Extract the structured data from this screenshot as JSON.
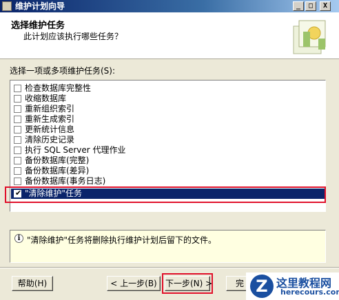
{
  "window": {
    "title": "维护计划向导",
    "minimize": "_",
    "maximize": "□",
    "close": "X"
  },
  "header": {
    "title": "选择维护任务",
    "subtitle": "此计划应该执行哪些任务？"
  },
  "task_list": {
    "label": "选择一项或多项维护任务(S):",
    "items": [
      {
        "label": "检查数据库完整性",
        "checked": false
      },
      {
        "label": "收缩数据库",
        "checked": false
      },
      {
        "label": "重新组织索引",
        "checked": false
      },
      {
        "label": "重新生成索引",
        "checked": false
      },
      {
        "label": "更新统计信息",
        "checked": false
      },
      {
        "label": "清除历史记录",
        "checked": false
      },
      {
        "label": "执行 SQL Server 代理作业",
        "checked": false
      },
      {
        "label": "备份数据库(完整)",
        "checked": false
      },
      {
        "label": "备份数据库(差异)",
        "checked": false
      },
      {
        "label": "备份数据库(事务日志)",
        "checked": false
      },
      {
        "label": "\"清除维护\"任务",
        "checked": true
      }
    ]
  },
  "description": {
    "icon": "info-icon",
    "text": "\"清除维护\"任务将删除执行维护计划后留下的文件。"
  },
  "buttons": {
    "help": "帮助(H)",
    "back": "< 上一步(B)",
    "next": "下一步(N) >",
    "finish": "完"
  },
  "watermark": {
    "logo": "Z",
    "title": "这里教程网",
    "url": "herecours.com"
  },
  "colors": {
    "selection": "#0a246a",
    "highlight_outline": "#e0102a",
    "info_background": "#ffffe1"
  }
}
